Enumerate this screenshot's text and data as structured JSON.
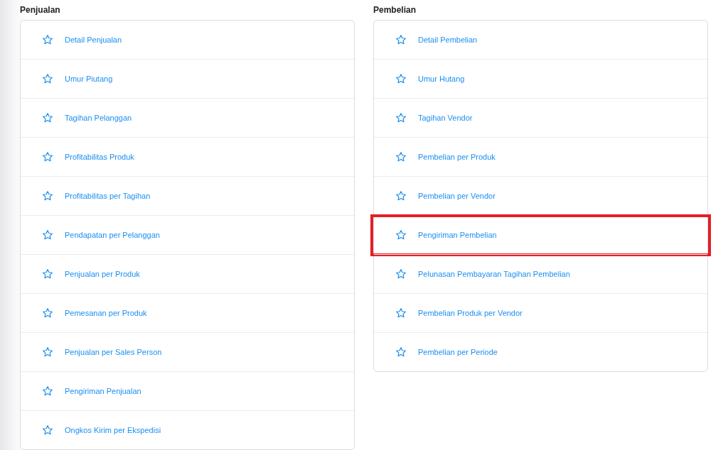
{
  "sections": [
    {
      "title": "Penjualan",
      "items": [
        {
          "label": "Detail Penjualan",
          "highlighted": false
        },
        {
          "label": "Umur Piutang",
          "highlighted": false
        },
        {
          "label": "Tagihan Pelanggan",
          "highlighted": false
        },
        {
          "label": "Profitabilitas Produk",
          "highlighted": false
        },
        {
          "label": "Profitabilitas per Tagihan",
          "highlighted": false
        },
        {
          "label": "Pendapatan per Pelanggan",
          "highlighted": false
        },
        {
          "label": "Penjualan per Produk",
          "highlighted": false
        },
        {
          "label": "Pemesanan per Produk",
          "highlighted": false
        },
        {
          "label": "Penjualan per Sales Person",
          "highlighted": false
        },
        {
          "label": "Pengiriman Penjualan",
          "highlighted": false
        },
        {
          "label": "Ongkos Kirim per Ekspedisi",
          "highlighted": false
        }
      ]
    },
    {
      "title": "Pembelian",
      "items": [
        {
          "label": "Detail Pembelian",
          "highlighted": false
        },
        {
          "label": "Umur Hutang",
          "highlighted": false
        },
        {
          "label": "Tagihan Vendor",
          "highlighted": false
        },
        {
          "label": "Pembelian per Produk",
          "highlighted": false
        },
        {
          "label": "Pembelian per Vendor",
          "highlighted": false
        },
        {
          "label": "Pengiriman Pembelian",
          "highlighted": true
        },
        {
          "label": "Pelunasan Pembayaran Tagihan Pembelian",
          "highlighted": false
        },
        {
          "label": "Pembelian Produk per Vendor",
          "highlighted": false
        },
        {
          "label": "Pembelian per Periode",
          "highlighted": false
        }
      ]
    }
  ]
}
